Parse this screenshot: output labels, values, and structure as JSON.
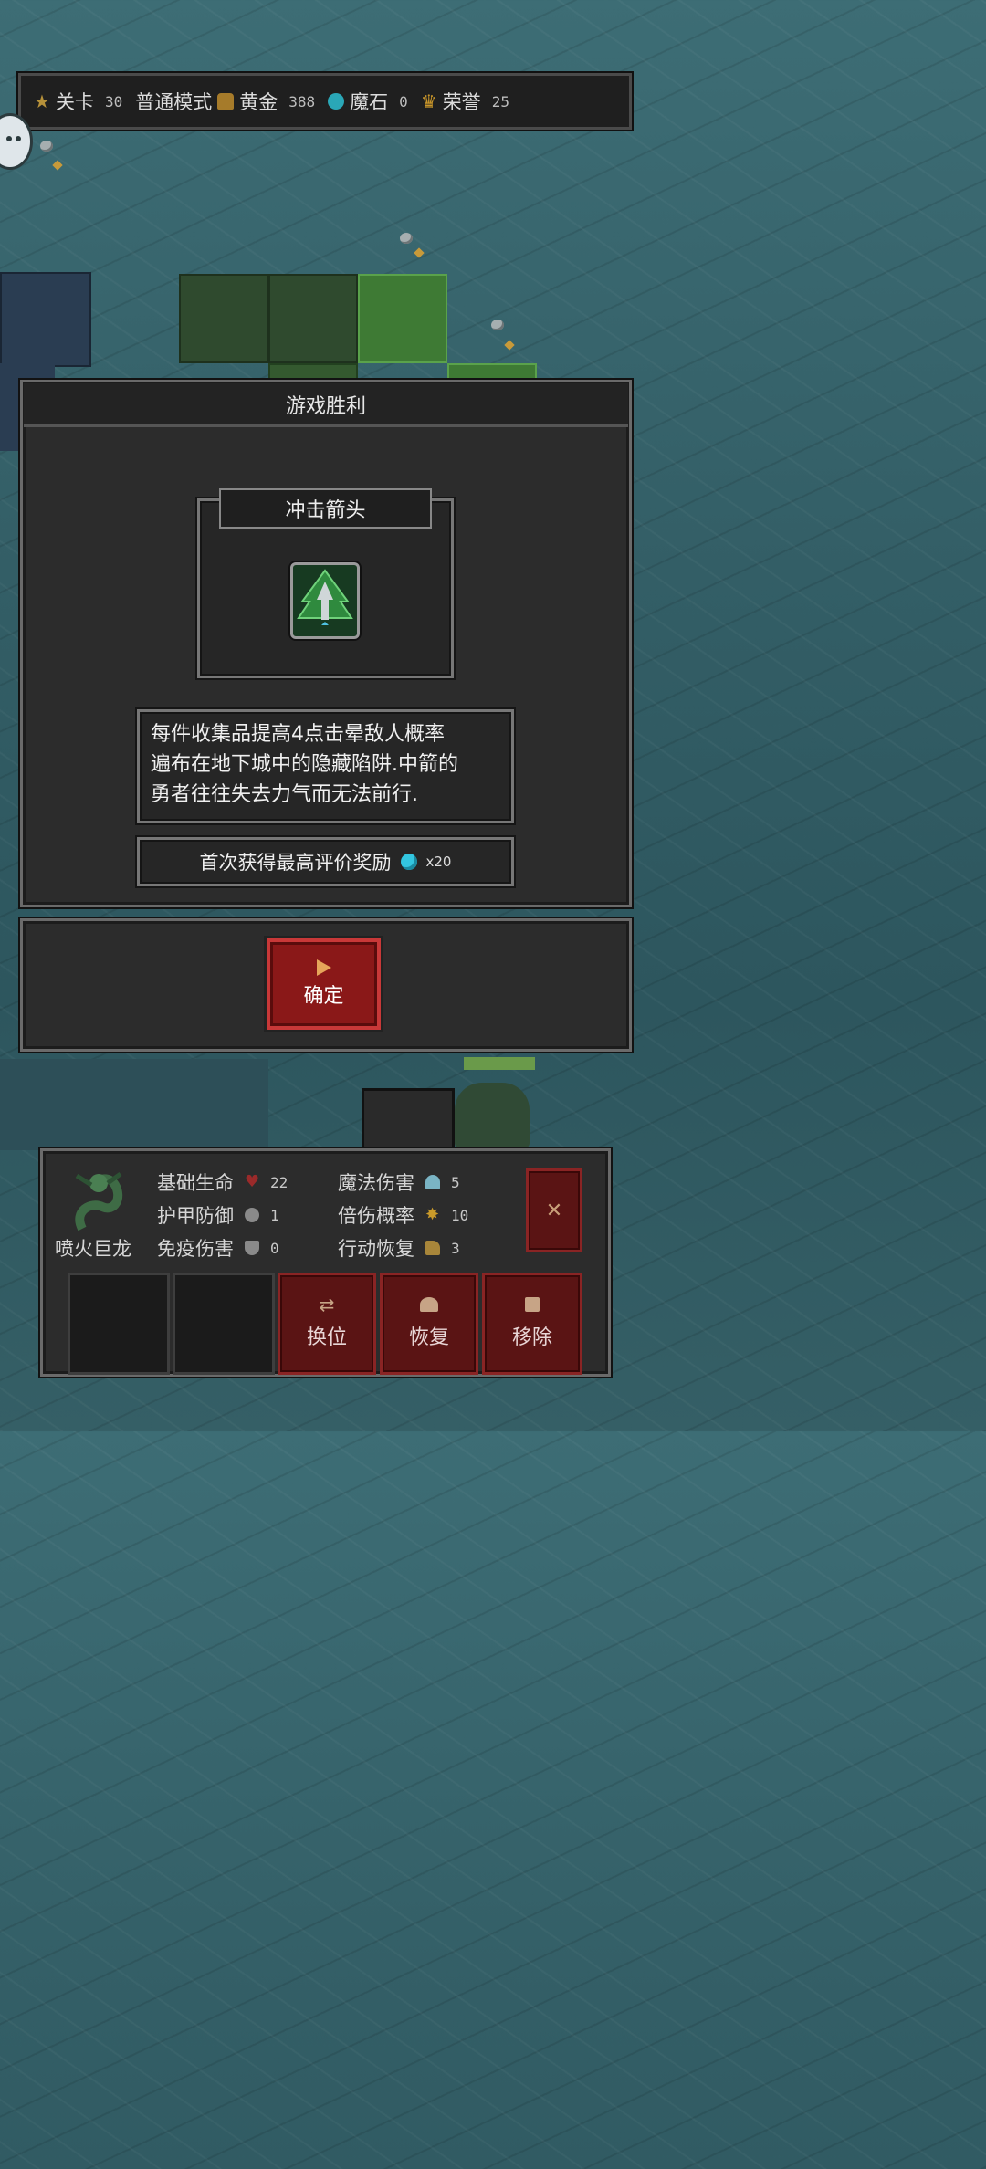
{
  "topbar": {
    "level_label": "关卡",
    "level_value": "30",
    "mode_label": "普通模式",
    "gold_label": "黄金",
    "gold_value": "388",
    "magicstone_label": "魔石",
    "magicstone_value": "0",
    "honor_label": "荣誉",
    "honor_value": "25",
    "icons": [
      "star-icon",
      "gold-bar-icon",
      "magic-stone-icon",
      "crown-icon"
    ]
  },
  "dialog": {
    "title": "游戏胜利",
    "item_name": "冲击箭头",
    "item_icon": "arrow-trap-icon",
    "description_lines": [
      "每件收集品提高4点击晕敌人概率",
      "遍布在地下城中的隐藏陷阱.中箭的",
      "勇者往往失去力气而无法前行."
    ],
    "reward_text": "首次获得最高评价奖励",
    "reward_count": "x20",
    "confirm_label": "确定"
  },
  "unit": {
    "name": "喷火巨龙",
    "stats": [
      {
        "label": "基础生命",
        "value": "22",
        "icon": "heart-icon"
      },
      {
        "label": "护甲防御",
        "value": "1",
        "icon": "armor-icon"
      },
      {
        "label": "免疫伤害",
        "value": "0",
        "icon": "shield-icon"
      },
      {
        "label": "魔法伤害",
        "value": "5",
        "icon": "magic-icon"
      },
      {
        "label": "倍伤概率",
        "value": "10",
        "icon": "crit-icon"
      },
      {
        "label": "行动恢复",
        "value": "3",
        "icon": "boot-icon"
      }
    ],
    "actions": [
      {
        "label": "换位",
        "icon": "swap-icon"
      },
      {
        "label": "恢复",
        "icon": "restore-icon"
      },
      {
        "label": "移除",
        "icon": "trash-icon"
      }
    ],
    "close_icon": "close-icon"
  },
  "colors": {
    "accent_red": "#8a1818",
    "gem": "#33c6e0",
    "gold": "#c9962a"
  }
}
